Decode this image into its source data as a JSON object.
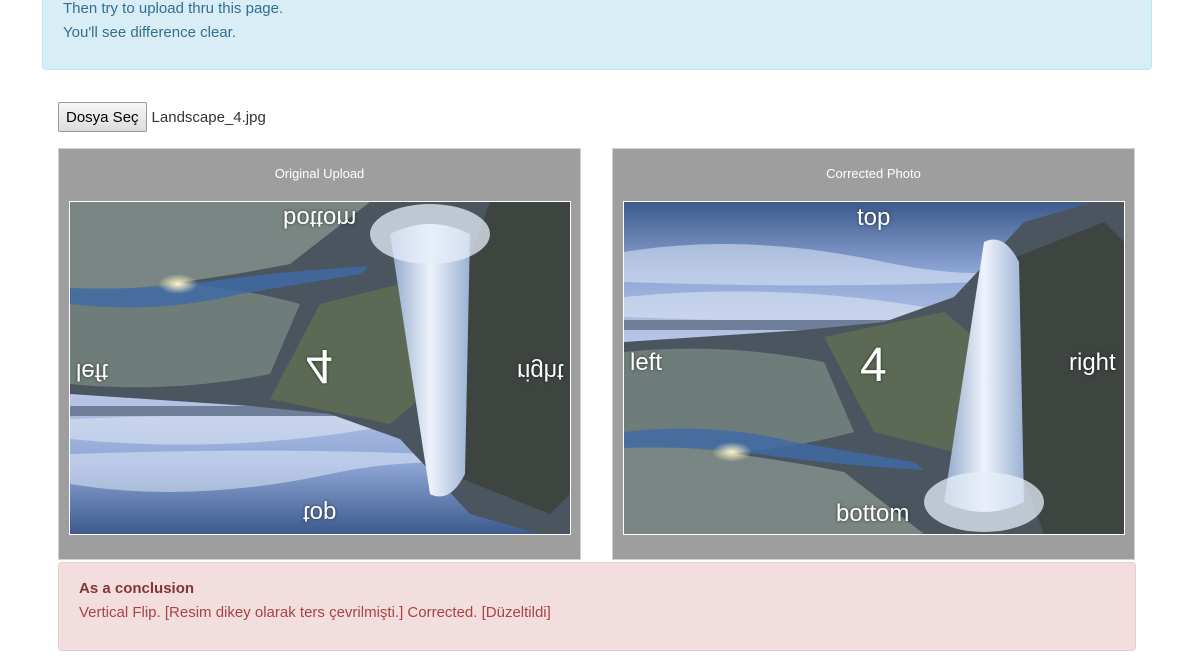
{
  "info_alert": {
    "line1": "Then try to upload thru this page.",
    "line2": "You'll see difference clear."
  },
  "upload": {
    "button_label": "Dosya Seç",
    "file_name": "Landscape_4.jpg"
  },
  "panels": {
    "original": {
      "title": "Original Upload",
      "labels": {
        "top": "top",
        "bottom": "bottom",
        "left": "left",
        "right": "right",
        "number": "4"
      }
    },
    "corrected": {
      "title": "Corrected Photo",
      "labels": {
        "top": "top",
        "bottom": "bottom",
        "left": "left",
        "right": "right",
        "number": "4"
      }
    }
  },
  "conclusion": {
    "heading": "As a conclusion",
    "text": "Vertical Flip. [Resim dikey olarak ters çevrilmişti.] Corrected. [Düzeltildi]"
  },
  "colors": {
    "info_bg": "#d9edf7",
    "danger_bg": "#f2dede",
    "panel_bg": "#9e9e9e"
  }
}
